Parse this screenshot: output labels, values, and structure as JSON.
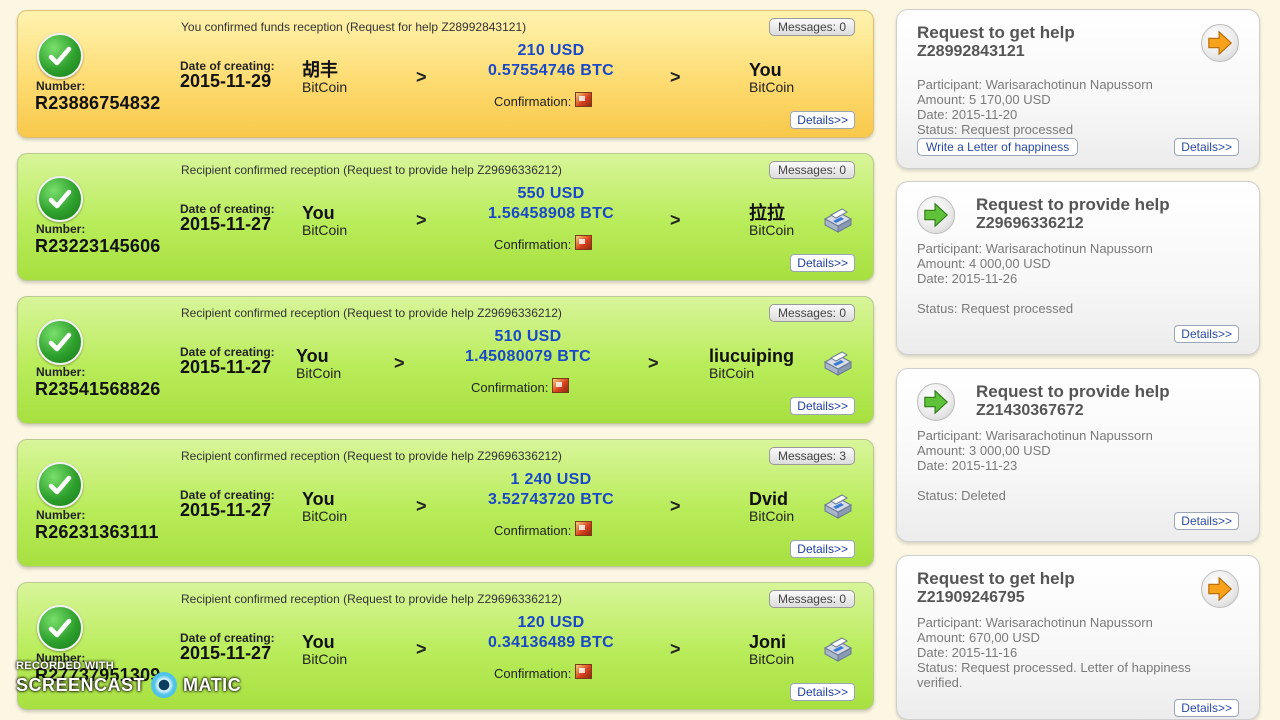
{
  "common": {
    "number_label": "Number:",
    "date_label": "Date of creating:",
    "confirmation_label": "Confirmation:",
    "details_label": "Details>>",
    "arrow_glyph": ">"
  },
  "requests": [
    {
      "theme": "orange",
      "status_text": "You confirmed funds reception (Request for help Z28992843121)",
      "messages": "Messages: 0",
      "number": "R23886754832",
      "date": "2015-11-29",
      "from_name": "胡丰",
      "from_type": "BitCoin",
      "usd": "210 USD",
      "btc": "0.57554746 BTC",
      "to_name": "You",
      "to_type": "BitCoin",
      "printer": false
    },
    {
      "theme": "green",
      "status_text": "Recipient confirmed reception (Request to provide help Z29696336212)",
      "messages": "Messages: 0",
      "number": "R23223145606",
      "date": "2015-11-27",
      "from_name": "You",
      "from_type": "BitCoin",
      "usd": "550 USD",
      "btc": "1.56458908 BTC",
      "to_name": "拉拉",
      "to_type": "BitCoin",
      "printer": true
    },
    {
      "theme": "green",
      "status_text": "Recipient confirmed reception (Request to provide help Z29696336212)",
      "messages": "Messages: 0",
      "number": "R23541568826",
      "date": "2015-11-27",
      "from_name": "You",
      "from_type": "BitCoin",
      "usd": "510 USD",
      "btc": "1.45080079 BTC",
      "to_name": "liucuiping",
      "to_type": "BitCoin",
      "printer": true
    },
    {
      "theme": "green",
      "status_text": "Recipient confirmed reception (Request to provide help Z29696336212)",
      "messages": "Messages: 3",
      "number": "R26231363111",
      "date": "2015-11-27",
      "from_name": "You",
      "from_type": "BitCoin",
      "usd": "1 240 USD",
      "btc": "3.52743720 BTC",
      "to_name": "Dvid",
      "to_type": "BitCoin",
      "printer": true
    },
    {
      "theme": "green",
      "status_text": "Recipient confirmed reception (Request to provide help Z29696336212)",
      "messages": "Messages: 0",
      "number": "R27737951309",
      "date": "2015-11-27",
      "from_name": "You",
      "from_type": "BitCoin",
      "usd": "120 USD",
      "btc": "0.34136489 BTC",
      "to_name": "Joni",
      "to_type": "BitCoin",
      "printer": true
    }
  ],
  "side_requests": [
    {
      "kind": "get",
      "title": "Request to get help",
      "id": "Z28992843121",
      "participant": "Participant: Warisarachotinun Napussorn",
      "amount": "Amount: 5 170,00 USD",
      "date": "Date: 2015-11-20",
      "status": "Status: Request processed",
      "status2": "",
      "letter_button": "Write a Letter of happiness",
      "icon": "orange-arrow-icon"
    },
    {
      "kind": "provide",
      "title": "Request to provide help",
      "id": "Z29696336212",
      "participant": "Participant: Warisarachotinun Napussorn",
      "amount": "Amount: 4 000,00 USD",
      "date": "Date: 2015-11-26",
      "status": "Status: Request processed",
      "status2": "",
      "letter_button": "",
      "icon": "green-arrow-icon"
    },
    {
      "kind": "provide",
      "title": "Request to provide help",
      "id": "Z21430367672",
      "participant": "Participant: Warisarachotinun Napussorn",
      "amount": "Amount: 3 000,00 USD",
      "date": "Date: 2015-11-23",
      "status": "Status: Deleted",
      "status2": "",
      "letter_button": "",
      "icon": "green-arrow-icon"
    },
    {
      "kind": "get",
      "title": "Request to get help",
      "id": "Z21909246795",
      "participant": "Participant: Warisarachotinun Napussorn",
      "amount": "Amount: 670,00 USD",
      "date": "Date: 2015-11-16",
      "status": "Status: Request processed. Letter of happiness",
      "status2": "verified.",
      "letter_button": "",
      "icon": "orange-arrow-icon"
    }
  ],
  "watermark": {
    "line1": "RECORDED WITH",
    "left": "SCREENCAST",
    "right": "MATIC"
  },
  "colors": {
    "green_card": "#b9ec5a",
    "orange_card": "#fddc72",
    "amount_blue": "#1a49c8"
  }
}
